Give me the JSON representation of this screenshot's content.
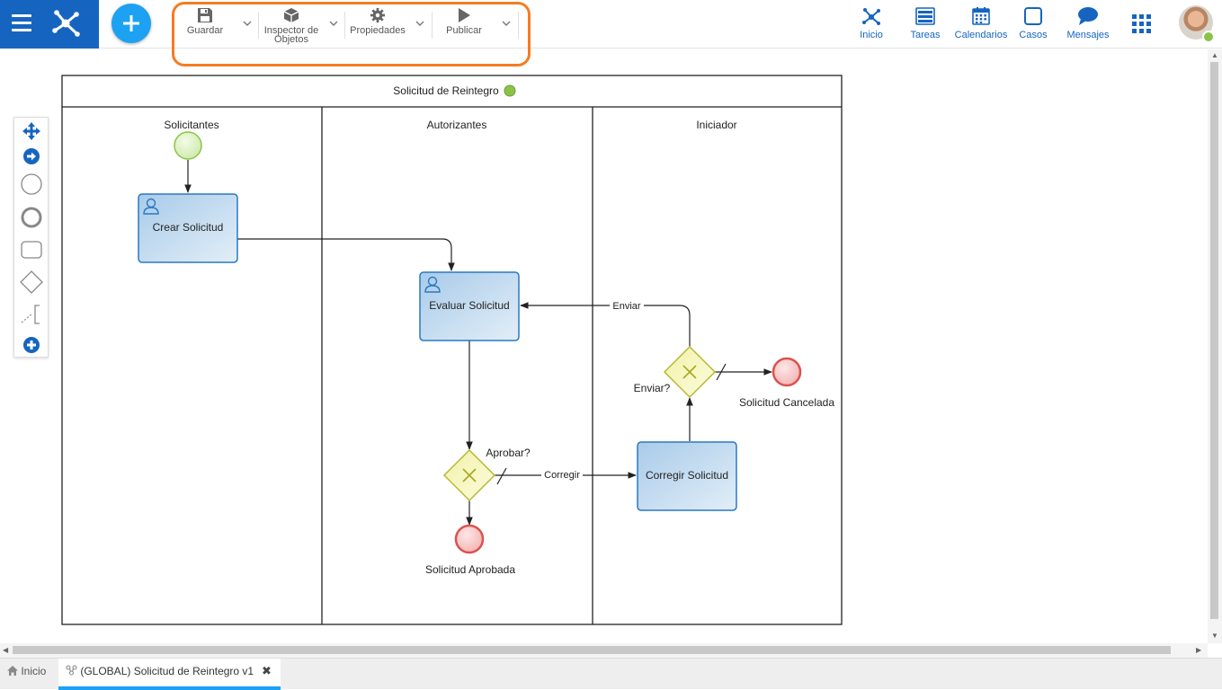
{
  "toolbar": {
    "save_label": "Guardar",
    "inspector_label_line1": "Inspector de",
    "inspector_label_line2": "Objetos",
    "properties_label": "Propiedades",
    "publish_label": "Publicar"
  },
  "nav": {
    "home_label": "Inicio",
    "tasks_label": "Tareas",
    "calendars_label": "Calendarios",
    "cases_label": "Casos",
    "messages_label": "Mensajes"
  },
  "diagram": {
    "pool_title": "Solicitud de Reintegro",
    "lanes": [
      "Solicitantes",
      "Autorizantes",
      "Iniciador"
    ],
    "tasks": {
      "create": "Crear Solicitud",
      "evaluate": "Evaluar Solicitud",
      "correct": "Corregir Solicitud"
    },
    "gateways": {
      "approve": "Aprobar?",
      "send": "Enviar?"
    },
    "end_events": {
      "approved": "Solicitud Aprobada",
      "cancelled": "Solicitud Cancelada"
    },
    "flow_labels": {
      "correct": "Corregir",
      "send": "Enviar"
    }
  },
  "tabs": {
    "home_label": "Inicio",
    "active_label": "(GLOBAL) Solicitud de Reintegro v1"
  },
  "colors": {
    "brand": "#1565c0",
    "accent": "#1da1f2",
    "highlight": "#f57c22",
    "task_fill": "#c8dff1",
    "gateway_fill": "#f5f5b8",
    "start_fill": "#dff3c8",
    "end_fill": "#f7c8c8"
  }
}
